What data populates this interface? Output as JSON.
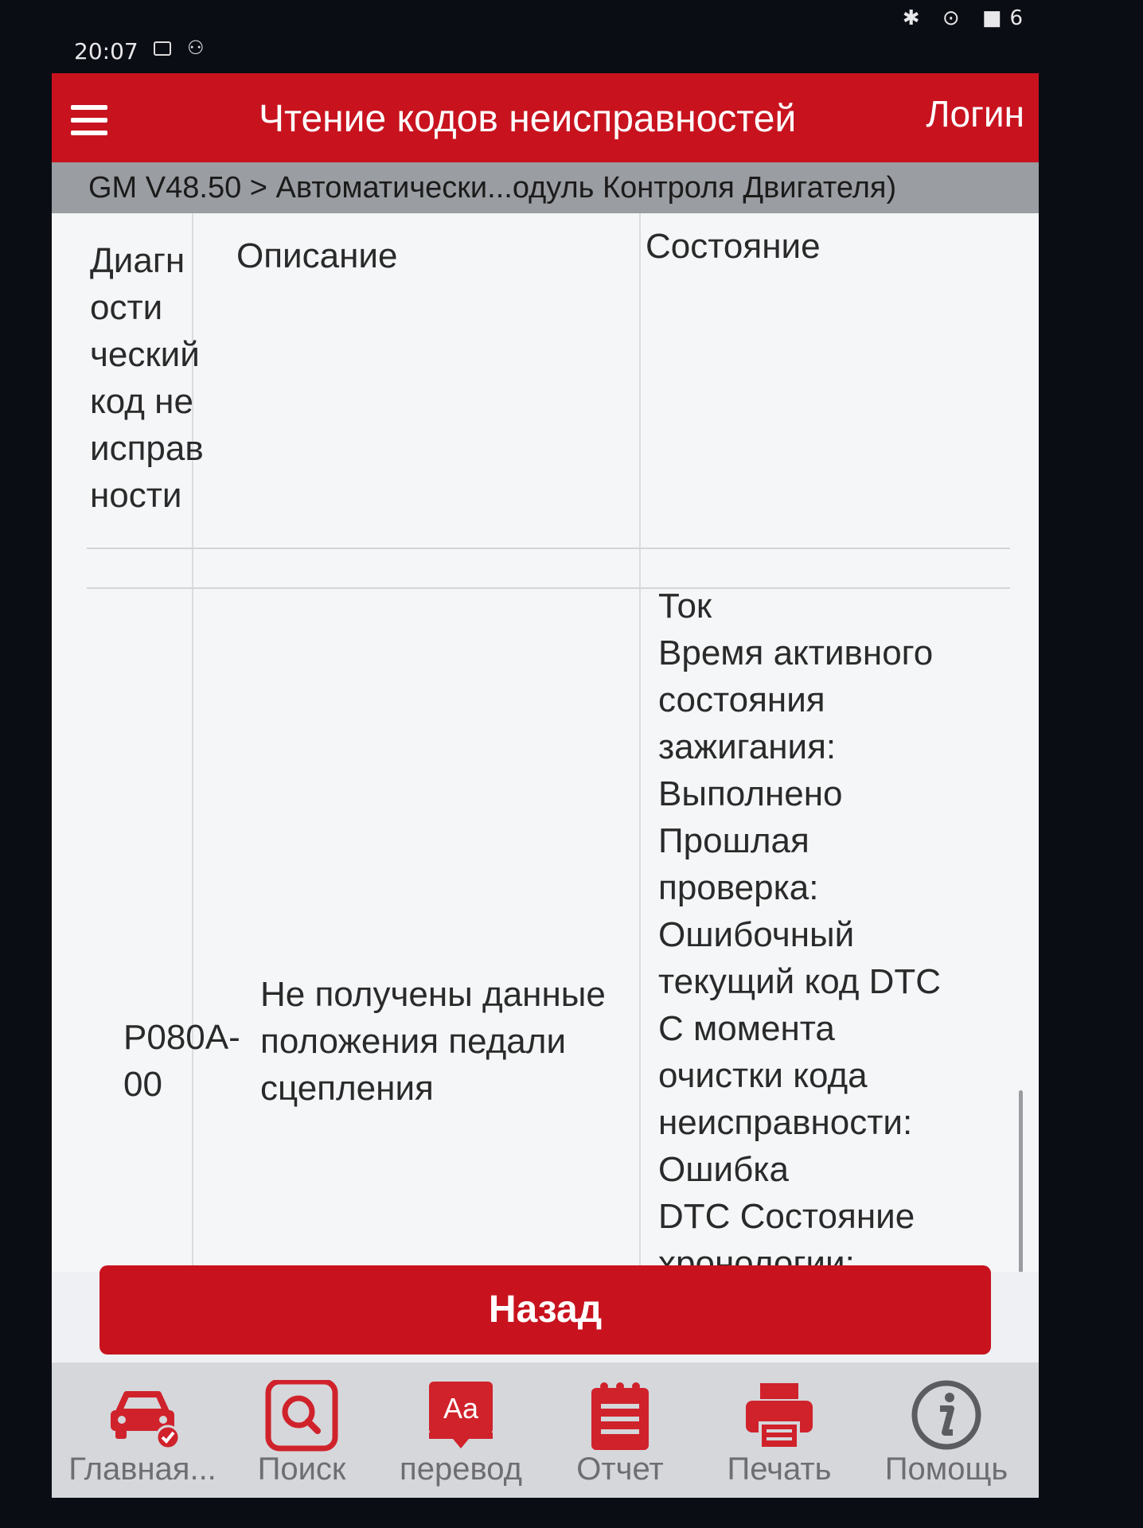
{
  "status_bar": {
    "time": "20:07",
    "right_icons": [
      "bluetooth-icon",
      "location-icon",
      "battery-icon"
    ],
    "right_text": "✱ ⊙ ■6"
  },
  "header": {
    "title": "Чтение кодов неисправностей",
    "login_label": "Логин"
  },
  "breadcrumb": "GM V48.50 > Автоматически...одуль Контроля Двигателя)",
  "table": {
    "columns": [
      "Диагностический код неисправности",
      "Описание",
      "Состояние"
    ],
    "column_lines": [
      "Диагн",
      "ости",
      "ческий",
      "код не",
      "исправ",
      "ности"
    ],
    "rows": [
      {
        "code": "P080A-00",
        "code_lines": [
          "P080A-",
          "00"
        ],
        "description_lines": [
          "Не получены данные",
          "положения педали",
          "сцепления"
        ],
        "status_lines": [
          "Ток",
          "Время активного",
          "состояния",
          "зажигания:",
          "Выполнено",
          "Прошлая",
          "проверка:",
          "Ошибочный",
          "текущий код DTC",
          "С момента",
          "очистки кода",
          "неисправности:",
          "Ошибка",
          "DTC Состояние",
          "хронологии:"
        ]
      }
    ]
  },
  "back_button": "Назад",
  "bottom_nav": [
    {
      "label": "Главная...",
      "icon": "car-icon"
    },
    {
      "label": "Поиск",
      "icon": "search-icon"
    },
    {
      "label": "перевод",
      "icon": "translate-icon"
    },
    {
      "label": "Отчет",
      "icon": "report-icon"
    },
    {
      "label": "Печать",
      "icon": "print-icon"
    },
    {
      "label": "Помощь",
      "icon": "help-icon"
    }
  ],
  "colors": {
    "accent": "#c8131f",
    "nav_icon": "#d0222b",
    "nav_label": "#6e6e72",
    "breadcrumb_bg": "#9a9da2"
  }
}
